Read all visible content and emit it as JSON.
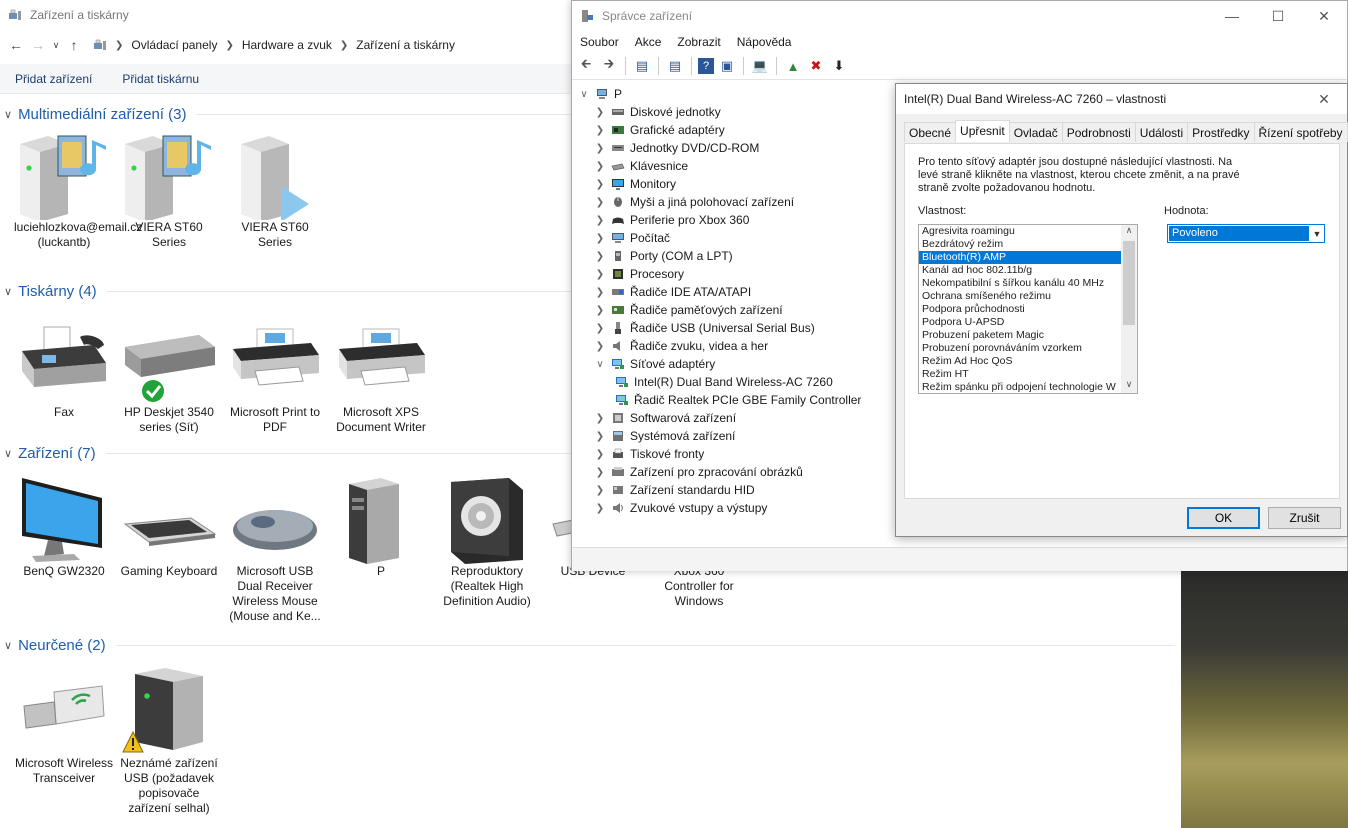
{
  "devices_window": {
    "title": "Zařízení a tiskárny",
    "breadcrumb": [
      "Ovládací panely",
      "Hardware a zvuk",
      "Zařízení a tiskárny"
    ],
    "commands": [
      "Přidat zařízení",
      "Přidat tiskárnu"
    ],
    "groups": [
      {
        "title": "Multimediální zařízení (3)",
        "items": [
          {
            "label": "luciehlozkova@email.cz (luckantb)",
            "icon": "media-server-icon"
          },
          {
            "label": "VIERA ST60 Series",
            "icon": "media-server-icon"
          },
          {
            "label": "VIERA ST60 Series",
            "icon": "media-player-icon"
          }
        ]
      },
      {
        "title": "Tiskárny (4)",
        "items": [
          {
            "label": "Fax",
            "icon": "fax-icon"
          },
          {
            "label": "HP Deskjet 3540 series (Síť)",
            "icon": "printer-default-icon"
          },
          {
            "label": "Microsoft Print to PDF",
            "icon": "printer-icon"
          },
          {
            "label": "Microsoft XPS Document Writer",
            "icon": "printer-icon"
          }
        ]
      },
      {
        "title": "Zařízení (7)",
        "items": [
          {
            "label": "BenQ GW2320",
            "icon": "monitor-icon"
          },
          {
            "label": "Gaming Keyboard",
            "icon": "keyboard-icon"
          },
          {
            "label": "Microsoft USB Dual Receiver Wireless Mouse (Mouse and Ke...",
            "icon": "mouse-icon"
          },
          {
            "label": "P",
            "icon": "computer-tower-icon"
          },
          {
            "label": "Reproduktory (Realtek High Definition Audio)",
            "icon": "speaker-icon"
          },
          {
            "label": "USB Device",
            "icon": "usb-device-icon"
          },
          {
            "label": "Xbox 360 Controller for Windows",
            "icon": "gamepad-icon"
          }
        ]
      },
      {
        "title": "Neurčené (2)",
        "items": [
          {
            "label": "Microsoft Wireless Transceiver",
            "icon": "usb-transceiver-icon"
          },
          {
            "label": "Neznámé zařízení USB (požadavek popisovače zařízení selhal)",
            "icon": "unknown-device-warning-icon"
          }
        ]
      }
    ]
  },
  "device_manager": {
    "title": "Správce zařízení",
    "menu": [
      "Soubor",
      "Akce",
      "Zobrazit",
      "Nápověda"
    ],
    "root": "P",
    "tree": [
      {
        "label": "Diskové jednotky",
        "icon": "disk-icon"
      },
      {
        "label": "Grafické adaptéry",
        "icon": "display-adapter-icon"
      },
      {
        "label": "Jednotky DVD/CD-ROM",
        "icon": "dvd-icon"
      },
      {
        "label": "Klávesnice",
        "icon": "keyboard-icon"
      },
      {
        "label": "Monitory",
        "icon": "monitor-icon"
      },
      {
        "label": "Myši a jiná polohovací zařízení",
        "icon": "mouse-icon"
      },
      {
        "label": "Periferie pro Xbox 360",
        "icon": "gamepad-icon"
      },
      {
        "label": "Počítač",
        "icon": "computer-icon"
      },
      {
        "label": "Porty (COM a LPT)",
        "icon": "port-icon"
      },
      {
        "label": "Procesory",
        "icon": "cpu-icon"
      },
      {
        "label": "Řadiče IDE ATA/ATAPI",
        "icon": "ide-icon"
      },
      {
        "label": "Řadiče paměťových zařízení",
        "icon": "storage-controller-icon"
      },
      {
        "label": "Řadiče USB (Universal Serial Bus)",
        "icon": "usb-icon"
      },
      {
        "label": "Řadiče zvuku, videa a her",
        "icon": "sound-icon"
      },
      {
        "label": "Síťové adaptéry",
        "icon": "network-icon",
        "expanded": true
      },
      {
        "label": "Intel(R) Dual Band Wireless-AC 7260",
        "icon": "network-icon",
        "child": true
      },
      {
        "label": "Řadič Realtek PCIe GBE Family Controller",
        "icon": "network-icon",
        "child": true
      },
      {
        "label": "Softwarová zařízení",
        "icon": "software-device-icon"
      },
      {
        "label": "Systémová zařízení",
        "icon": "system-device-icon"
      },
      {
        "label": "Tiskové fronty",
        "icon": "print-queue-icon"
      },
      {
        "label": "Zařízení pro zpracování obrázků",
        "icon": "imaging-icon"
      },
      {
        "label": "Zařízení standardu HID",
        "icon": "hid-icon"
      },
      {
        "label": "Zvukové vstupy a výstupy",
        "icon": "audio-io-icon"
      }
    ]
  },
  "properties_dialog": {
    "title": "Intel(R) Dual Band Wireless-AC 7260 – vlastnosti",
    "tabs": [
      "Obecné",
      "Upřesnit",
      "Ovladač",
      "Podrobnosti",
      "Události",
      "Prostředky",
      "Řízení spotřeby"
    ],
    "selected_tab": "Upřesnit",
    "description": "Pro tento síťový adaptér jsou dostupné následující vlastnosti. Na levé straně klikněte na vlastnost, kterou chcete změnit, a na pravé straně zvolte požadovanou hodnotu.",
    "property_label": "Vlastnost:",
    "value_label": "Hodnota:",
    "properties": [
      "Agresivita roamingu",
      "Bezdrátový režim",
      "Bluetooth(R) AMP",
      "Kanál ad hoc 802.11b/g",
      "Nekompatibilní s šířkou kanálu 40 MHz",
      "Ochrana smíšeného režimu",
      "Podpora průchodnosti",
      "Podpora U-APSD",
      "Probuzení paketem Magic",
      "Probuzení porovnáváním vzorkem",
      "Režim Ad Hoc QoS",
      "Režim HT",
      "Režim spánku při odpojení technologie W"
    ],
    "selected_property": "Bluetooth(R) AMP",
    "value": "Povoleno",
    "ok_label": "OK",
    "cancel_label": "Zrušit"
  }
}
